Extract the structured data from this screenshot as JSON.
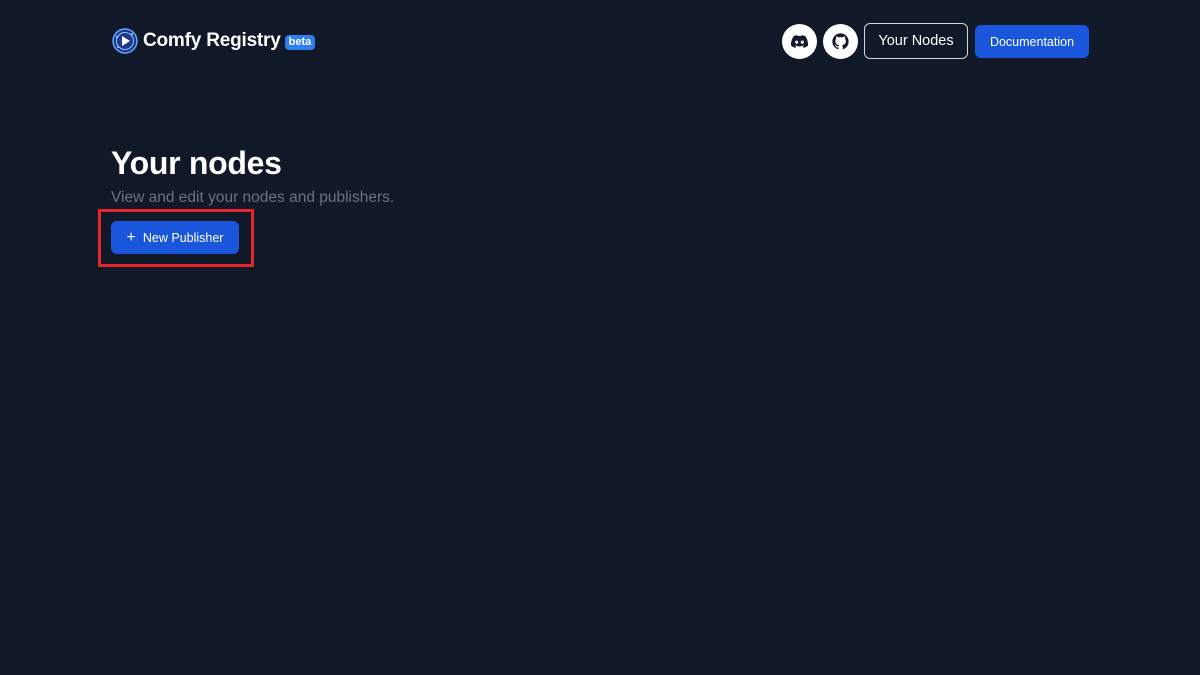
{
  "header": {
    "brand_name": "Comfy Registry",
    "beta_label": "beta",
    "discord_icon": "discord-icon",
    "github_icon": "github-icon",
    "your_nodes_label": "Your Nodes",
    "documentation_label": "Documentation"
  },
  "main": {
    "title": "Your nodes",
    "subtitle": "View and edit your nodes and publishers.",
    "new_publisher_label": "New Publisher",
    "new_publisher_icon": "plus-icon"
  },
  "colors": {
    "background": "#111827",
    "primary": "#1a56db",
    "beta_badge": "#2f7ff0",
    "subtitle_text": "#6b7280",
    "highlight": "#e5262c"
  }
}
